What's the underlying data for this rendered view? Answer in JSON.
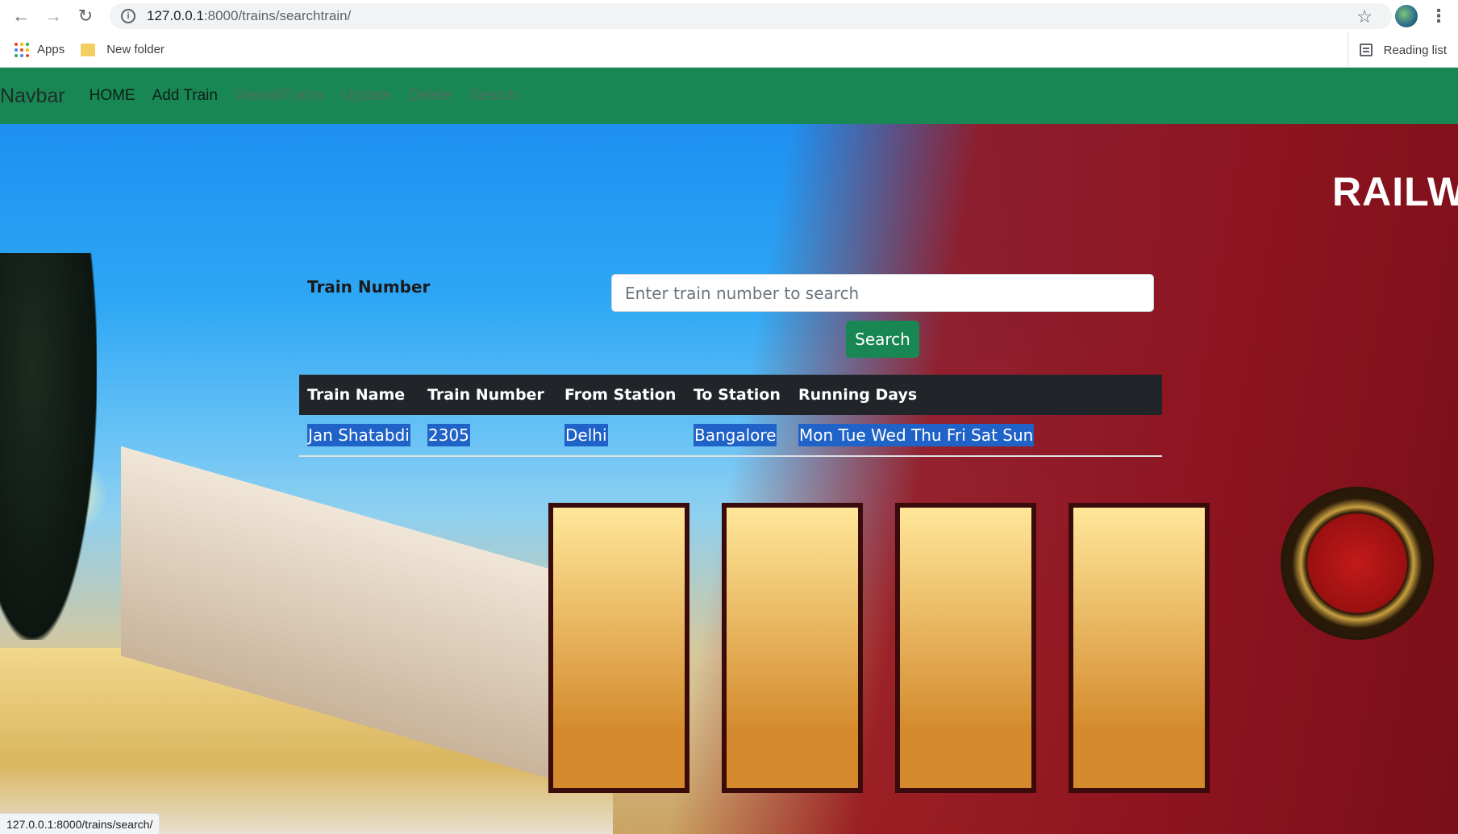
{
  "browser": {
    "url_host": "127.0.0.1",
    "url_path": ":8000/trains/searchtrain/",
    "bookmarks": {
      "apps_label": "Apps",
      "folder_label": "New folder"
    },
    "reading_list_label": "Reading list",
    "status_url": "127.0.0.1:8000/trains/search/"
  },
  "navbar": {
    "brand": "Navbar",
    "links": [
      "HOME",
      "Add Train",
      "ViewallTrains",
      "Update",
      "Delete",
      "Search"
    ]
  },
  "hero": {
    "title": "RAILW"
  },
  "search": {
    "label": "Train Number",
    "placeholder": "Enter train number to search",
    "button_label": "Search"
  },
  "table": {
    "headers": [
      "Train Name",
      "Train Number",
      "From Station",
      "To Station",
      "Running Days"
    ],
    "rows": [
      [
        "Jan Shatabdi",
        "2305",
        "Delhi",
        "Bangalore",
        "Mon Tue Wed Thu Fri Sat Sun"
      ]
    ]
  },
  "colors": {
    "navbar_bg": "#198754",
    "button_bg": "#198754",
    "table_header_bg": "#212529",
    "selection_bg": "#1f63c8"
  }
}
